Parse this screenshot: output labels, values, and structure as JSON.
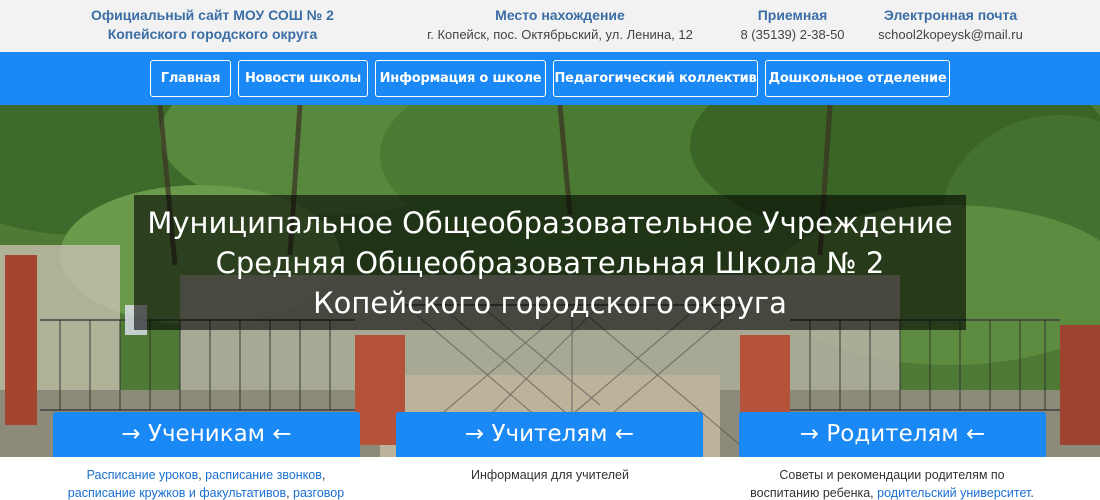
{
  "header": {
    "site_title_line1": "Официальный сайт МОУ СОШ № 2",
    "site_title_line2": "Копейского городского округа",
    "location_label": "Место нахождение",
    "location_value": "г. Копейск, пос. Октябрьский, ул. Ленина, 12",
    "phone_label": "Приемная",
    "phone_value": "8 (35139) 2-38-50",
    "email_label": "Электронная почта",
    "email_value": "school2kopeysk@mail.ru"
  },
  "nav": {
    "items": [
      {
        "label": "Главная"
      },
      {
        "label": "Новости школы"
      },
      {
        "label": "Информация о школе"
      },
      {
        "label": "Педагогический коллектив"
      },
      {
        "label": "Дошкольное отделение"
      }
    ]
  },
  "hero": {
    "line1": "Муниципальное Общеобразовательное Учреждение",
    "line2": "Средняя Общеобразовательная Школа № 2",
    "line3": "Копейского городского округа"
  },
  "audience": {
    "students": {
      "label": "→ Ученикам ←",
      "link1": "Расписание уроков",
      "sep1": ", ",
      "link2": "расписание звонков",
      "sep2": ",",
      "link3": "расписание кружков и факультативов",
      "sep3": ", ",
      "link4": "разговор"
    },
    "teachers": {
      "label": "→ Учителям ←",
      "desc": "Информация для учителей"
    },
    "parents": {
      "label": "→ Родителям ←",
      "desc_line1": "Советы и рекомендации родителям по",
      "desc_line2": "воспитанию ребенка, ",
      "link": "родительский университет",
      "end": "."
    }
  },
  "colors": {
    "nav_bg": "#1a88f5",
    "header_bg": "#f2f2f2",
    "title_color": "#3a6ea5",
    "link_color": "#1a6fd0"
  }
}
